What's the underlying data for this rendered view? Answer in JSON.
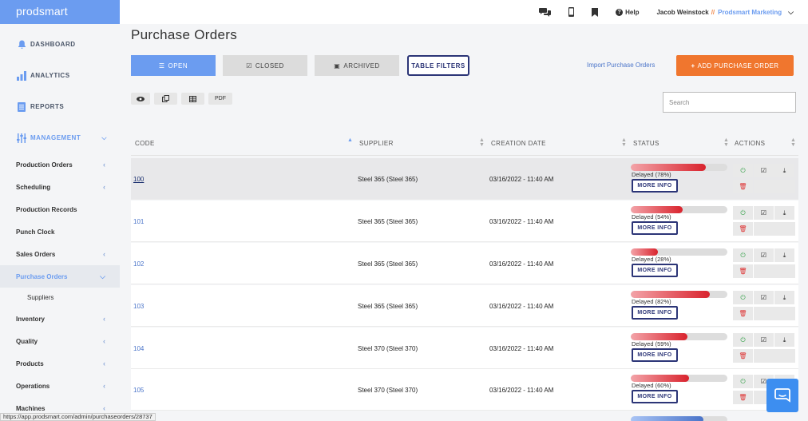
{
  "brand": "prodsmart",
  "sidebar": {
    "top": [
      {
        "label": "DASHBOARD",
        "icon": "bell-icon"
      },
      {
        "label": "ANALYTICS",
        "icon": "bar-chart-icon"
      },
      {
        "label": "REPORTS",
        "icon": "document-icon"
      },
      {
        "label": "MANAGEMENT",
        "icon": "sliders-icon"
      }
    ],
    "items": [
      {
        "label": "Production Orders"
      },
      {
        "label": "Scheduling"
      },
      {
        "label": "Production Records"
      },
      {
        "label": "Punch Clock"
      },
      {
        "label": "Sales Orders"
      },
      {
        "label": "Purchase Orders"
      },
      {
        "label": "Suppliers"
      },
      {
        "label": "Inventory"
      },
      {
        "label": "Quality"
      },
      {
        "label": "Products"
      },
      {
        "label": "Operations"
      },
      {
        "label": "Machines"
      }
    ]
  },
  "topbar": {
    "help": "Help",
    "user": "Jacob Weinstock",
    "separator": "//",
    "company": "Prodsmart Marketing"
  },
  "page": {
    "title": "Purchase Orders",
    "tabs": {
      "open": "OPEN",
      "closed": "CLOSED",
      "archived": "ARCHIVED",
      "filters": "TABLE FILTERS"
    },
    "import": "Import Purchase Orders",
    "add": "ADD PURCHASE ORDER",
    "export_pdf": "PDF",
    "search_placeholder": "Search"
  },
  "table": {
    "headers": {
      "code": "CODE",
      "supplier": "SUPPLIER",
      "date": "CREATION DATE",
      "status": "STATUS",
      "actions": "ACTIONS"
    },
    "more_info": "MORE INFO",
    "rows": [
      {
        "code": "100",
        "supplier": "Steel 365 (Steel 365)",
        "date": "03/16/2022 - 11:40 AM",
        "status": "Delayed (78%)",
        "progress": 78
      },
      {
        "code": "101",
        "supplier": "Steel 365 (Steel 365)",
        "date": "03/16/2022 - 11:40 AM",
        "status": "Delayed (54%)",
        "progress": 54
      },
      {
        "code": "102",
        "supplier": "Steel 365 (Steel 365)",
        "date": "03/16/2022 - 11:40 AM",
        "status": "Delayed (28%)",
        "progress": 28
      },
      {
        "code": "103",
        "supplier": "Steel 365 (Steel 365)",
        "date": "03/16/2022 - 11:40 AM",
        "status": "Delayed (82%)",
        "progress": 82
      },
      {
        "code": "104",
        "supplier": "Steel 370 (Steel 370)",
        "date": "03/16/2022 - 11:40 AM",
        "status": "Delayed (59%)",
        "progress": 59
      },
      {
        "code": "105",
        "supplier": "Steel 370 (Steel 370)",
        "date": "03/16/2022 - 11:40 AM",
        "status": "Delayed (60%)",
        "progress": 60
      }
    ]
  },
  "statusbar": "https://app.prodsmart.com/admin/purchaseorders/28737",
  "colors": {
    "accent": "#6b9cf0",
    "orange": "#f0762e",
    "navy": "#2c3577",
    "delayed": "#d9232d"
  }
}
